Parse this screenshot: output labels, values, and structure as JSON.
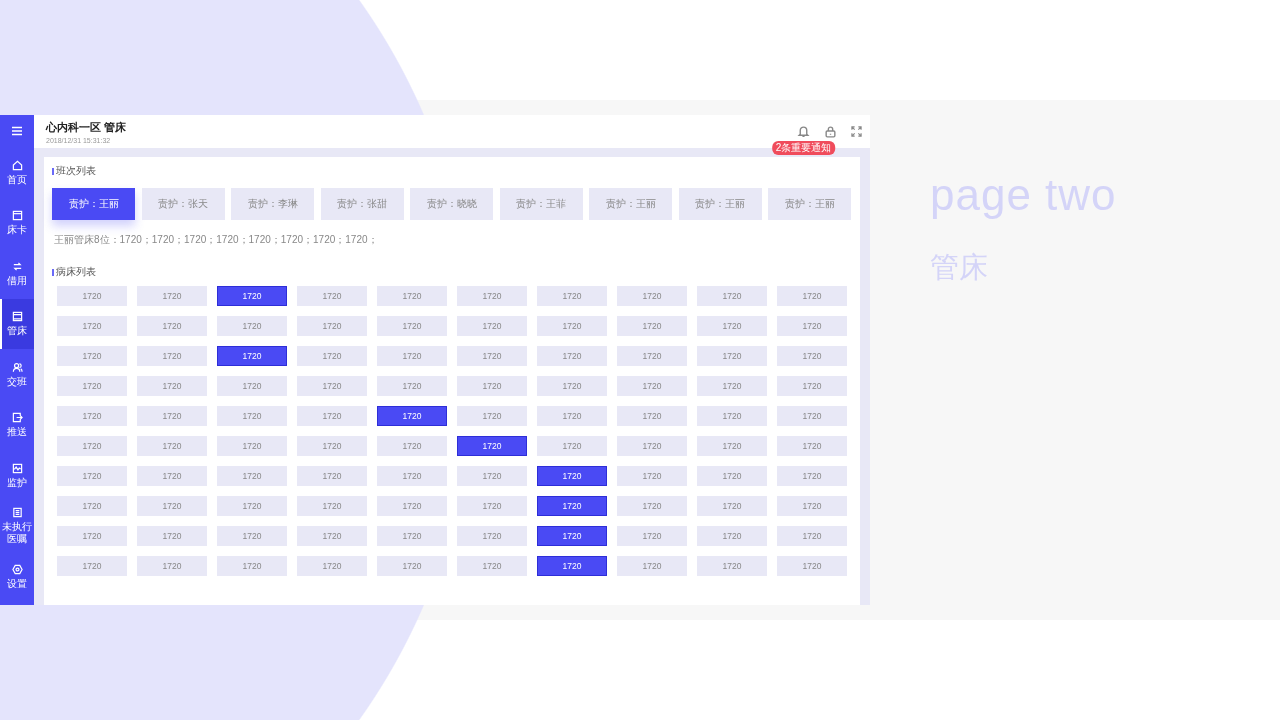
{
  "sidebar": {
    "items": [
      {
        "label": "首页",
        "selected": false
      },
      {
        "label": "床卡",
        "selected": false
      },
      {
        "label": "借用",
        "selected": false
      },
      {
        "label": "管床",
        "selected": true
      },
      {
        "label": "交班",
        "selected": false
      },
      {
        "label": "推送",
        "selected": false
      },
      {
        "label": "监护",
        "selected": false
      },
      {
        "label": "未执行医嘱",
        "selected": false
      },
      {
        "label": "设置",
        "selected": false
      }
    ]
  },
  "header": {
    "title": "心内科一区 管床",
    "timestamp": "2018/12/31 15:31:32",
    "badge": "2条重要通知"
  },
  "shift_list": {
    "title": "班次列表",
    "nurses": [
      {
        "label": "责护：王丽",
        "selected": true
      },
      {
        "label": "责护：张天",
        "selected": false
      },
      {
        "label": "责护：李琳",
        "selected": false
      },
      {
        "label": "责护：张甜",
        "selected": false
      },
      {
        "label": "责护：晓晓",
        "selected": false
      },
      {
        "label": "责护：王菲",
        "selected": false
      },
      {
        "label": "责护：王丽",
        "selected": false
      },
      {
        "label": "责护：王丽",
        "selected": false
      },
      {
        "label": "责护：王丽",
        "selected": false
      }
    ],
    "summary": "王丽管床8位：1720；1720；1720；1720；1720；1720；1720；1720；"
  },
  "bed_list": {
    "title": "病床列表",
    "rows": [
      {
        "beds": [
          {
            "label": "1720",
            "selected": false
          },
          {
            "label": "1720",
            "selected": false
          },
          {
            "label": "1720",
            "selected": true
          },
          {
            "label": "1720",
            "selected": false
          },
          {
            "label": "1720",
            "selected": false
          },
          {
            "label": "1720",
            "selected": false
          },
          {
            "label": "1720",
            "selected": false
          },
          {
            "label": "1720",
            "selected": false
          },
          {
            "label": "1720",
            "selected": false
          },
          {
            "label": "1720",
            "selected": false
          }
        ]
      },
      {
        "beds": [
          {
            "label": "1720",
            "selected": false
          },
          {
            "label": "1720",
            "selected": false
          },
          {
            "label": "1720",
            "selected": false
          },
          {
            "label": "1720",
            "selected": false
          },
          {
            "label": "1720",
            "selected": false
          },
          {
            "label": "1720",
            "selected": false
          },
          {
            "label": "1720",
            "selected": false
          },
          {
            "label": "1720",
            "selected": false
          },
          {
            "label": "1720",
            "selected": false
          },
          {
            "label": "1720",
            "selected": false
          }
        ]
      },
      {
        "beds": [
          {
            "label": "1720",
            "selected": false
          },
          {
            "label": "1720",
            "selected": false
          },
          {
            "label": "1720",
            "selected": true
          },
          {
            "label": "1720",
            "selected": false
          },
          {
            "label": "1720",
            "selected": false
          },
          {
            "label": "1720",
            "selected": false
          },
          {
            "label": "1720",
            "selected": false
          },
          {
            "label": "1720",
            "selected": false
          },
          {
            "label": "1720",
            "selected": false
          },
          {
            "label": "1720",
            "selected": false
          }
        ]
      },
      {
        "beds": [
          {
            "label": "1720",
            "selected": false
          },
          {
            "label": "1720",
            "selected": false
          },
          {
            "label": "1720",
            "selected": false
          },
          {
            "label": "1720",
            "selected": false
          },
          {
            "label": "1720",
            "selected": false
          },
          {
            "label": "1720",
            "selected": false
          },
          {
            "label": "1720",
            "selected": false
          },
          {
            "label": "1720",
            "selected": false
          },
          {
            "label": "1720",
            "selected": false
          },
          {
            "label": "1720",
            "selected": false
          }
        ]
      },
      {
        "beds": [
          {
            "label": "1720",
            "selected": false
          },
          {
            "label": "1720",
            "selected": false
          },
          {
            "label": "1720",
            "selected": false
          },
          {
            "label": "1720",
            "selected": false
          },
          {
            "label": "1720",
            "selected": true
          },
          {
            "label": "1720",
            "selected": false
          },
          {
            "label": "1720",
            "selected": false
          },
          {
            "label": "1720",
            "selected": false
          },
          {
            "label": "1720",
            "selected": false
          },
          {
            "label": "1720",
            "selected": false
          }
        ]
      },
      {
        "beds": [
          {
            "label": "1720",
            "selected": false
          },
          {
            "label": "1720",
            "selected": false
          },
          {
            "label": "1720",
            "selected": false
          },
          {
            "label": "1720",
            "selected": false
          },
          {
            "label": "1720",
            "selected": false
          },
          {
            "label": "1720",
            "selected": true
          },
          {
            "label": "1720",
            "selected": false
          },
          {
            "label": "1720",
            "selected": false
          },
          {
            "label": "1720",
            "selected": false
          },
          {
            "label": "1720",
            "selected": false
          }
        ]
      },
      {
        "beds": [
          {
            "label": "1720",
            "selected": false
          },
          {
            "label": "1720",
            "selected": false
          },
          {
            "label": "1720",
            "selected": false
          },
          {
            "label": "1720",
            "selected": false
          },
          {
            "label": "1720",
            "selected": false
          },
          {
            "label": "1720",
            "selected": false
          },
          {
            "label": "1720",
            "selected": true
          },
          {
            "label": "1720",
            "selected": false
          },
          {
            "label": "1720",
            "selected": false
          },
          {
            "label": "1720",
            "selected": false
          }
        ]
      },
      {
        "beds": [
          {
            "label": "1720",
            "selected": false
          },
          {
            "label": "1720",
            "selected": false
          },
          {
            "label": "1720",
            "selected": false
          },
          {
            "label": "1720",
            "selected": false
          },
          {
            "label": "1720",
            "selected": false
          },
          {
            "label": "1720",
            "selected": false
          },
          {
            "label": "1720",
            "selected": true
          },
          {
            "label": "1720",
            "selected": false
          },
          {
            "label": "1720",
            "selected": false
          },
          {
            "label": "1720",
            "selected": false
          }
        ]
      },
      {
        "beds": [
          {
            "label": "1720",
            "selected": false
          },
          {
            "label": "1720",
            "selected": false
          },
          {
            "label": "1720",
            "selected": false
          },
          {
            "label": "1720",
            "selected": false
          },
          {
            "label": "1720",
            "selected": false
          },
          {
            "label": "1720",
            "selected": false
          },
          {
            "label": "1720",
            "selected": true
          },
          {
            "label": "1720",
            "selected": false
          },
          {
            "label": "1720",
            "selected": false
          },
          {
            "label": "1720",
            "selected": false
          }
        ]
      },
      {
        "beds": [
          {
            "label": "1720",
            "selected": false
          },
          {
            "label": "1720",
            "selected": false
          },
          {
            "label": "1720",
            "selected": false
          },
          {
            "label": "1720",
            "selected": false
          },
          {
            "label": "1720",
            "selected": false
          },
          {
            "label": "1720",
            "selected": false
          },
          {
            "label": "1720",
            "selected": true
          },
          {
            "label": "1720",
            "selected": false
          },
          {
            "label": "1720",
            "selected": false
          },
          {
            "label": "1720",
            "selected": false
          }
        ]
      }
    ]
  },
  "caption": {
    "title": "page two",
    "subtitle": "管床"
  }
}
